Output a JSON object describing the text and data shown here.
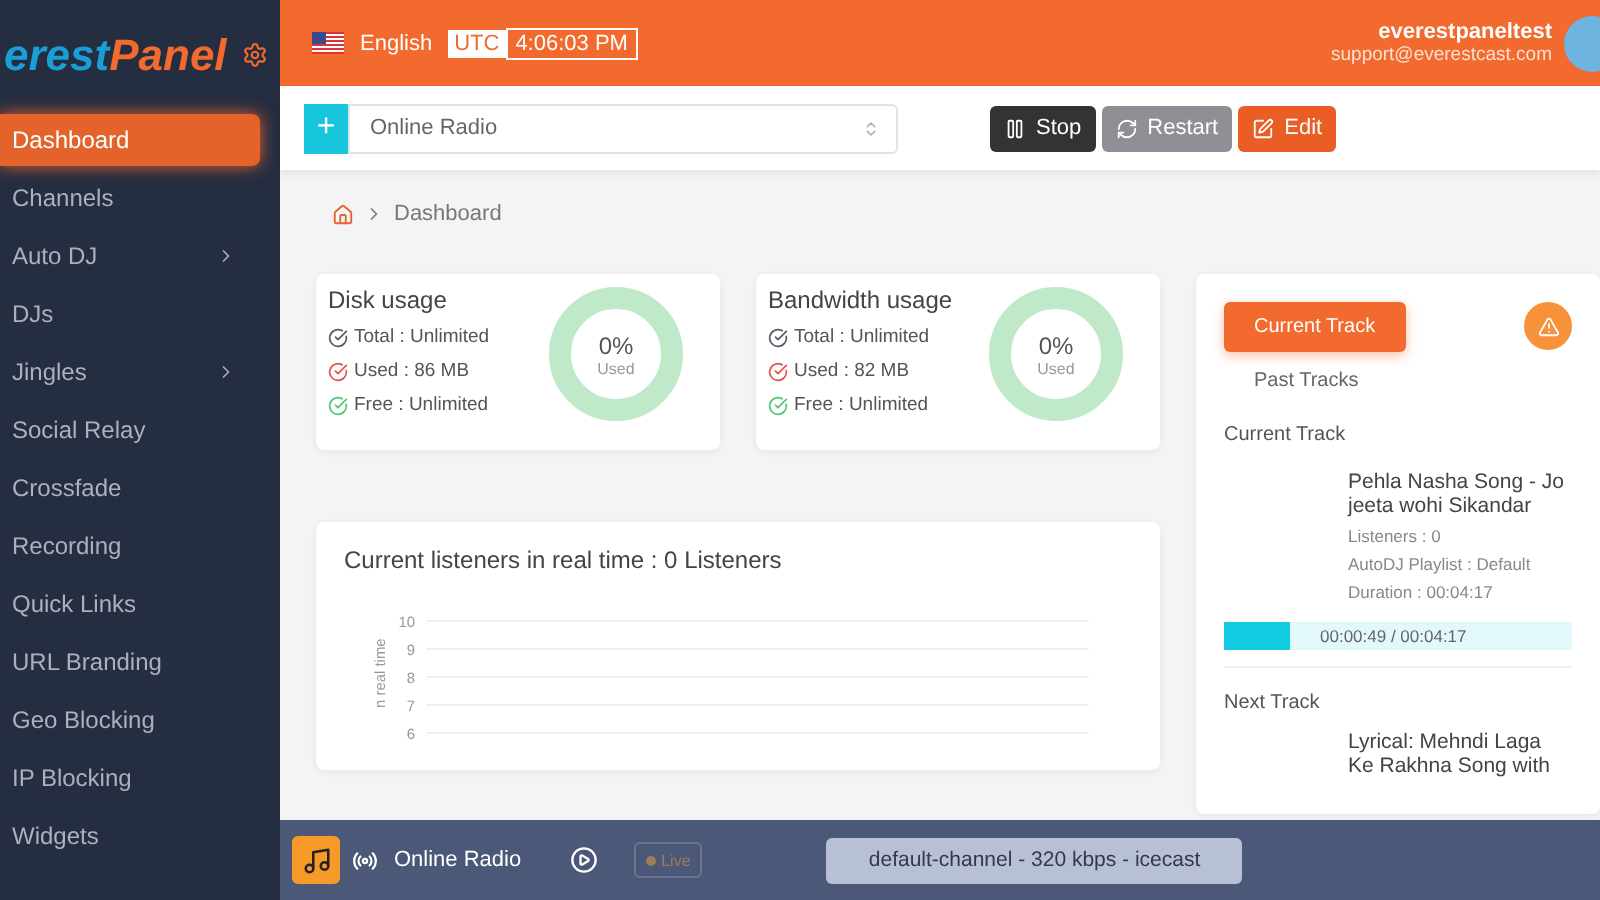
{
  "logo": {
    "word_1": "erest",
    "word_2": "Panel"
  },
  "sidebar": {
    "items": [
      {
        "label": "Dashboard",
        "selected": true,
        "has_submenu": false
      },
      {
        "label": "Channels",
        "selected": false,
        "has_submenu": false
      },
      {
        "label": "Auto DJ",
        "selected": false,
        "has_submenu": true
      },
      {
        "label": "DJs",
        "selected": false,
        "has_submenu": false
      },
      {
        "label": "Jingles",
        "selected": false,
        "has_submenu": true
      },
      {
        "label": "Social Relay",
        "selected": false,
        "has_submenu": false
      },
      {
        "label": "Crossfade",
        "selected": false,
        "has_submenu": false
      },
      {
        "label": "Recording",
        "selected": false,
        "has_submenu": false
      },
      {
        "label": "Quick Links",
        "selected": false,
        "has_submenu": false
      },
      {
        "label": "URL Branding",
        "selected": false,
        "has_submenu": false
      },
      {
        "label": "Geo Blocking",
        "selected": false,
        "has_submenu": false
      },
      {
        "label": "IP Blocking",
        "selected": false,
        "has_submenu": false
      },
      {
        "label": "Widgets",
        "selected": false,
        "has_submenu": false
      }
    ]
  },
  "header": {
    "language": "English",
    "timezone": "UTC",
    "time": "4:06:03 PM",
    "user": {
      "name": "everestpaneltest",
      "email": "support@everestcast.com"
    }
  },
  "toolbar": {
    "add_button": "+",
    "channel_select": {
      "value": "Online Radio"
    },
    "buttons": [
      {
        "label": "Stop",
        "kind": "stop"
      },
      {
        "label": "Restart",
        "kind": "restart"
      },
      {
        "label": "Edit",
        "kind": "edit"
      }
    ]
  },
  "breadcrumb": [
    "Dashboard"
  ],
  "usage_cards": [
    {
      "title": "Disk usage",
      "lines": [
        {
          "text": "Total : Unlimited",
          "color": "#555a66"
        },
        {
          "text": "Used : 86 MB",
          "color": "#e0524a"
        },
        {
          "text": "Free : Unlimited",
          "color": "#4cc772"
        }
      ],
      "gauge": {
        "reading": "0%",
        "caption": "Used",
        "level": 0
      }
    },
    {
      "title": "Bandwidth usage",
      "lines": [
        {
          "text": "Total : Unlimited",
          "color": "#555a66"
        },
        {
          "text": "Used : 82 MB",
          "color": "#e0524a"
        },
        {
          "text": "Free : Unlimited",
          "color": "#4cc772"
        }
      ],
      "gauge": {
        "reading": "0%",
        "caption": "Used",
        "level": 0
      }
    }
  ],
  "listeners_card": {
    "title": "Current listeners in real time : 0 Listeners",
    "y_axis": {
      "label": "n real time",
      "ticks": [
        "10",
        "9",
        "8",
        "7",
        "6"
      ]
    }
  },
  "tracks_panel": {
    "tabs": [
      {
        "label": "Current Track",
        "selected": true
      },
      {
        "label": "Past Tracks",
        "selected": false
      }
    ],
    "current": {
      "heading": "Current Track",
      "title": "Pehla Nasha Song - Jo jeeta wohi Sikandar",
      "details": [
        "Listeners : 0",
        "AutoDJ Playlist : Default",
        "Duration : 00:04:17"
      ],
      "progress": {
        "level": 0.19,
        "reading": "00:00:49 / 00:04:17"
      }
    },
    "next": {
      "heading": "Next Track",
      "title": "Lyrical: Mehndi Laga Ke Rakhna Song with"
    }
  },
  "player": {
    "station": "Online Radio",
    "live": {
      "label": "Live",
      "on": false
    },
    "stream_info": "default-channel - 320 kbps - icecast"
  }
}
